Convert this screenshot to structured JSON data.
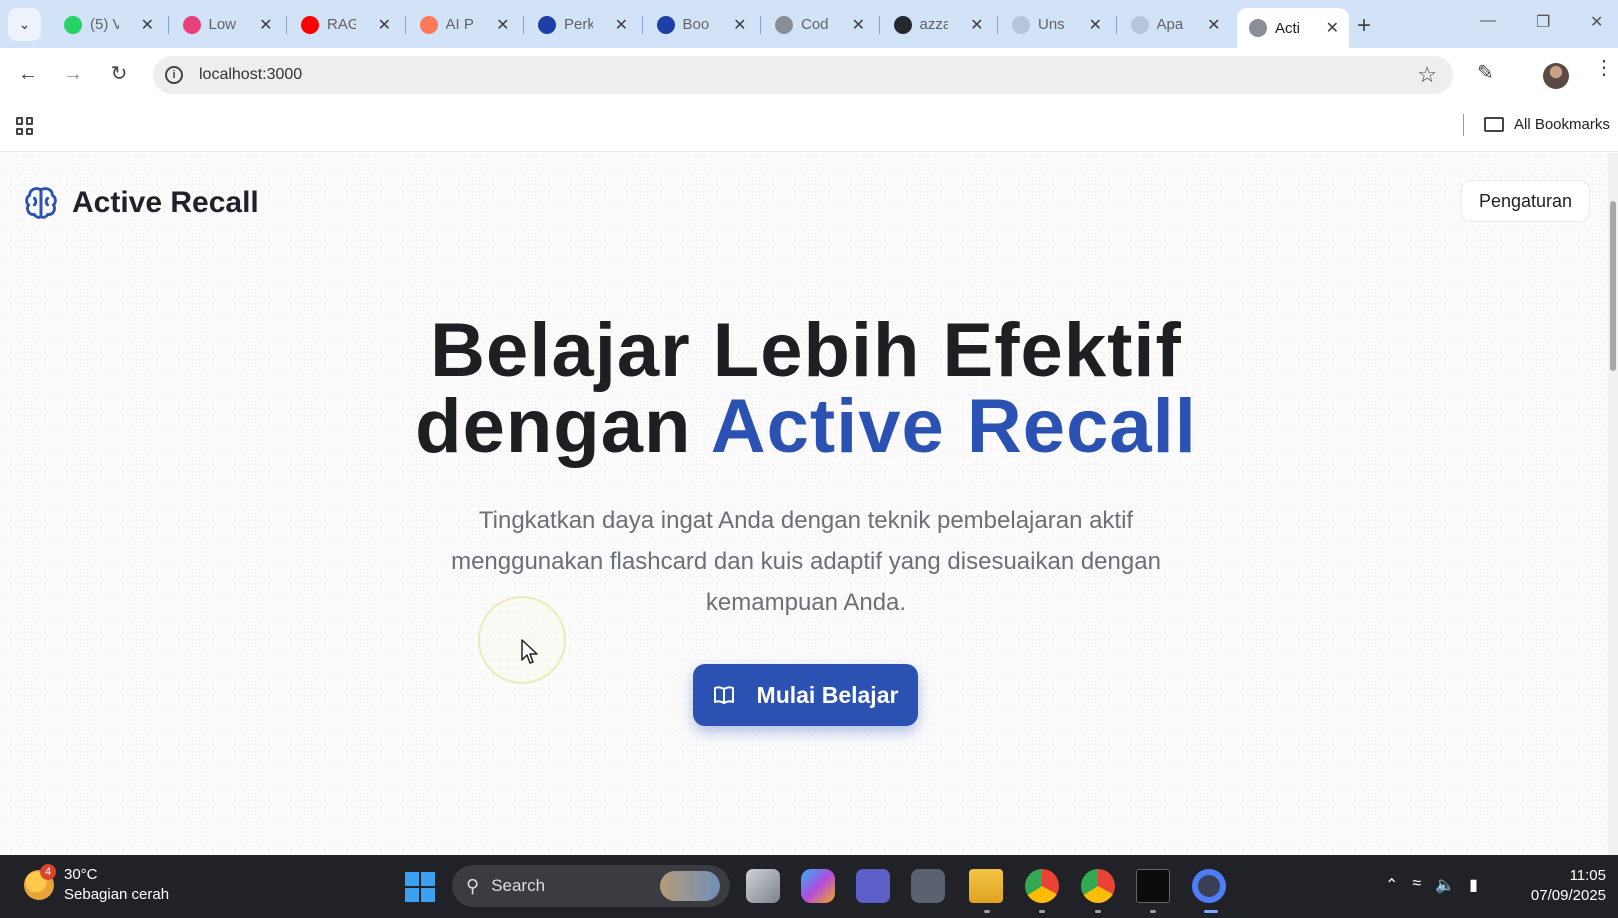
{
  "browser": {
    "tabs": [
      {
        "title": "(5) V",
        "icon": "whatsapp-icon",
        "color": "#25d366"
      },
      {
        "title": "Low",
        "icon": "tumblr-icon",
        "color": "#e9407a"
      },
      {
        "title": "RAG",
        "icon": "youtube-icon",
        "color": "#ff0000"
      },
      {
        "title": "AI P",
        "icon": "hubspot-icon",
        "color": "#ff7a59"
      },
      {
        "title": "Perk",
        "icon": "checkmark-icon",
        "color": "#1f3fa8"
      },
      {
        "title": "Boo",
        "icon": "checkmark-icon",
        "color": "#1f3fa8"
      },
      {
        "title": "Cod",
        "icon": "globe-icon",
        "color": "#8a8f96"
      },
      {
        "title": "azza",
        "icon": "github-icon",
        "color": "#24292f"
      },
      {
        "title": "Uns",
        "icon": "unsplash-icon",
        "color": "#b8c4d8"
      },
      {
        "title": "Apa",
        "icon": "globe-icon",
        "color": "#b8c4d8"
      },
      {
        "title": "Acti",
        "icon": "globe-icon",
        "color": "#8a8f96",
        "active": true
      }
    ],
    "url": "localhost:3000",
    "bookmarks_label": "All Bookmarks"
  },
  "app": {
    "brand": "Active Recall",
    "settings_label": "Pengaturan",
    "hero": {
      "line1": "Belajar Lebih Efektif",
      "line2_plain": "dengan",
      "line2_accent": "Active Recall"
    },
    "subtitle": "Tingkatkan daya ingat Anda dengan teknik pembelajaran aktif menggunakan flashcard dan kuis adaptif yang disesuaikan dengan kemampuan Anda.",
    "cta_label": "Mulai Belajar",
    "accent_color": "#2b52b2"
  },
  "taskbar": {
    "weather_temp": "30°C",
    "weather_desc": "Sebagian cerah",
    "weather_badge": "4",
    "search_placeholder": "Search",
    "time": "11:05",
    "date": "07/09/2025"
  }
}
